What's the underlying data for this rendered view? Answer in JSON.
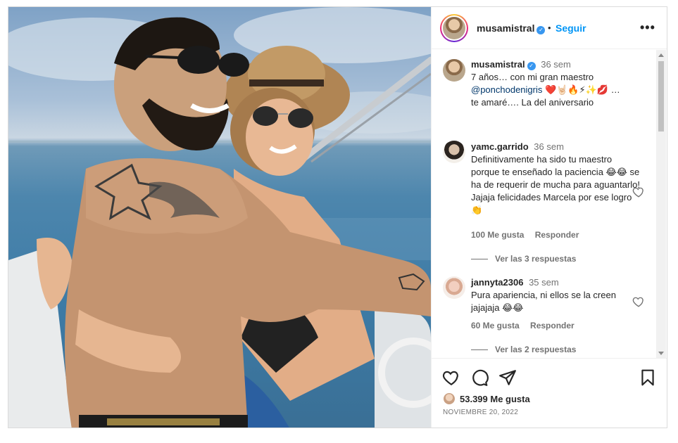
{
  "post": {
    "header": {
      "username": "musamistral",
      "dot": "•",
      "follow_label": "Seguir",
      "more_label": "•••"
    },
    "caption": {
      "username": "musamistral",
      "time": "36 sem",
      "text_1": "7 años… con mi gran maestro",
      "mention": "@ponchodenigris",
      "emojis": "❤️🤘🏻🔥⚡✨💋",
      "text_2": "…",
      "text_3": "te amaré…. La del aniversario"
    },
    "comments": [
      {
        "username": "yamc.garrido",
        "time": "36 sem",
        "text": "Definitivamente ha sido tu maestro porque te enseñado la paciencia 😂😂 se ha de requerir de mucha para aguantarlo! Jajaja felicidades Marcela por ese logro 👏",
        "likes": "100 Me gusta",
        "reply": "Responder",
        "view_replies": "Ver las 3 respuestas"
      },
      {
        "username": "jannyta2306",
        "time": "35 sem",
        "text": "Pura apariencia, ni ellos se la creen jajajaja 😂😂",
        "likes": "60 Me gusta",
        "reply": "Responder",
        "view_replies": "Ver las 2 respuestas"
      }
    ],
    "footer": {
      "likes_count": "53.399 Me gusta",
      "date": "NOVIEMBRE 20, 2022"
    },
    "icons": {
      "like": "heart-icon",
      "comment": "comment-icon",
      "share": "send-icon",
      "save": "bookmark-icon",
      "verified": "verified-badge-icon"
    },
    "colors": {
      "link": "#0095f6",
      "mention": "#00376b",
      "verified": "#3897f0",
      "secondary_text": "#737373"
    }
  }
}
